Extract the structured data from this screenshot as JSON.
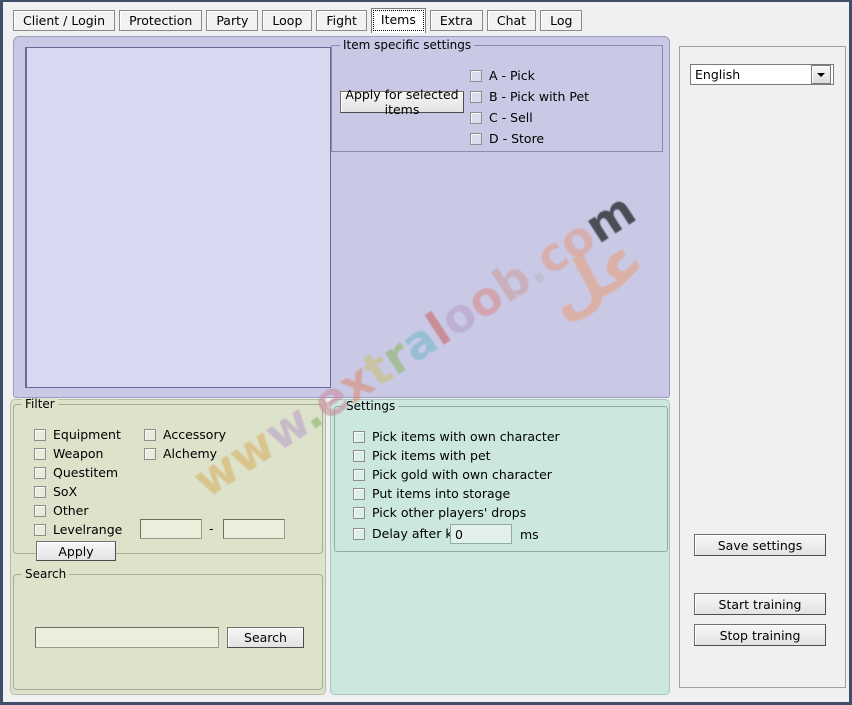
{
  "window": {
    "border_color": "#3f4f6b",
    "background": "#f0f0f0"
  },
  "tabs": {
    "items": [
      {
        "label": "Client / Login",
        "active": false
      },
      {
        "label": "Protection",
        "active": false
      },
      {
        "label": "Party",
        "active": false
      },
      {
        "label": "Loop",
        "active": false
      },
      {
        "label": "Fight",
        "active": false
      },
      {
        "label": "Items",
        "active": true
      },
      {
        "label": "Extra",
        "active": false
      },
      {
        "label": "Chat",
        "active": false
      },
      {
        "label": "Log",
        "active": false
      }
    ]
  },
  "item_list": {
    "name": "items-listbox",
    "entries": [],
    "background": "#d8d8f0"
  },
  "item_specific_settings": {
    "title": "Item specific settings",
    "apply_button": "Apply for selected items",
    "checkboxes": [
      {
        "label": "A - Pick",
        "checked": false
      },
      {
        "label": "B - Pick with Pet",
        "checked": false
      },
      {
        "label": "C - Sell",
        "checked": false
      },
      {
        "label": "D - Store",
        "checked": false
      }
    ]
  },
  "filter": {
    "title": "Filter",
    "checkboxes_col1": [
      {
        "label": "Equipment",
        "checked": false
      },
      {
        "label": "Weapon",
        "checked": false
      },
      {
        "label": "Questitem",
        "checked": false
      },
      {
        "label": "SoX",
        "checked": false
      },
      {
        "label": "Other",
        "checked": false
      },
      {
        "label": "Levelrange",
        "checked": false
      }
    ],
    "checkboxes_col2": [
      {
        "label": "Accessory",
        "checked": false
      },
      {
        "label": "Alchemy",
        "checked": false
      }
    ],
    "level_from": "",
    "level_from_placeholder": "",
    "level_separator": "-",
    "level_to": "",
    "level_to_placeholder": "",
    "apply_button": "Apply"
  },
  "search": {
    "title": "Search",
    "input_value": "",
    "input_placeholder": "",
    "button": "Search"
  },
  "settings": {
    "title": "Settings",
    "checkboxes": [
      {
        "label": "Pick items with own character",
        "checked": false
      },
      {
        "label": "Pick items with pet",
        "checked": false
      },
      {
        "label": "Pick gold with own character",
        "checked": false
      },
      {
        "label": "Put items into storage",
        "checked": false
      },
      {
        "label": "Pick other players' drops",
        "checked": false
      }
    ],
    "delay": {
      "label": "Delay after kill",
      "checked": false,
      "value": "0",
      "unit": "ms"
    }
  },
  "sidebar": {
    "language": {
      "selected": "English",
      "options": [
        "English"
      ],
      "dropdown_icon": "chevron-down-icon"
    },
    "buttons": [
      {
        "label": "Save settings",
        "name": "save-settings-button"
      },
      {
        "label": "Start training",
        "name": "start-training-button"
      },
      {
        "label": "Stop training",
        "name": "stop-training-button"
      }
    ]
  },
  "watermark": {
    "text": "www.extraloob.com",
    "glyph": "عل"
  },
  "colors": {
    "tabpage": "#c9c9e6",
    "listbox": "#d8d8f0",
    "filter_panel": "#dde2cb",
    "settings_panel": "#cbe7df",
    "sidebar": "#f0f0f0"
  }
}
